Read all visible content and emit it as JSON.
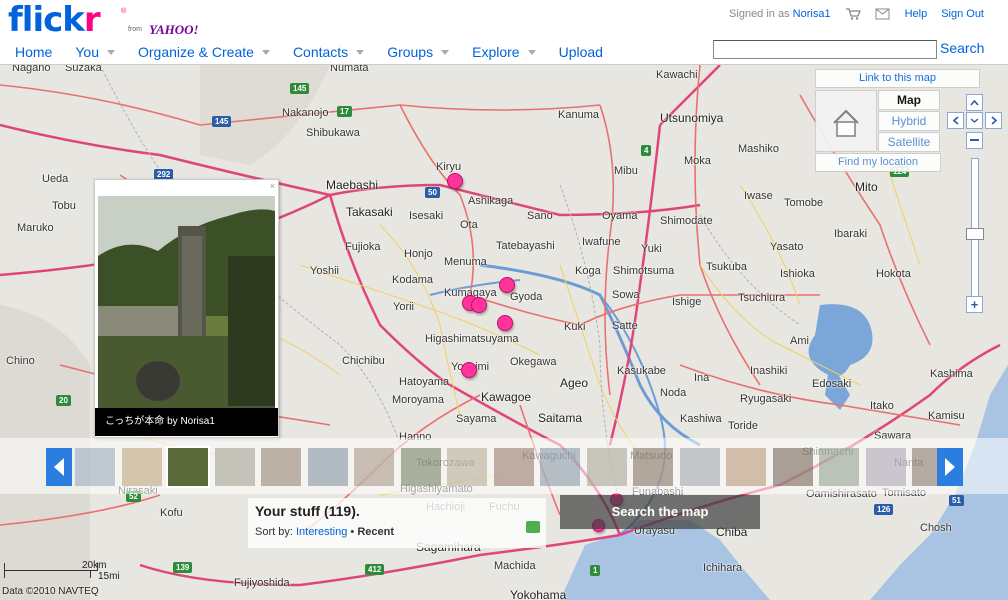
{
  "header": {
    "logo_word": "flickr",
    "logo_reg": "®",
    "logo_from": "from",
    "logo_yahoo": "YAHOO!",
    "signed_in_prefix": "Signed in as",
    "username": "Norisa1",
    "help": "Help",
    "sign_out": "Sign Out",
    "nav": [
      {
        "label": "Home",
        "caret": false
      },
      {
        "label": "You",
        "caret": true
      },
      {
        "label": "Organize & Create",
        "caret": true
      },
      {
        "label": "Contacts",
        "caret": true
      },
      {
        "label": "Groups",
        "caret": true
      },
      {
        "label": "Explore",
        "caret": true
      },
      {
        "label": "Upload",
        "caret": false
      }
    ],
    "search_value": "",
    "search_button": "Search"
  },
  "map_controls": {
    "link_to_map": "Link to this map",
    "map": "Map",
    "hybrid": "Hybrid",
    "satellite": "Satellite",
    "find_location": "Find my location",
    "zoom_in": "+"
  },
  "cities": [
    {
      "name": "Nagano",
      "big": false
    },
    {
      "name": "Suzaka",
      "big": false
    },
    {
      "name": "Numata",
      "big": false
    },
    {
      "name": "Kawachi",
      "big": false
    },
    {
      "name": "Kanuma",
      "big": false
    },
    {
      "name": "Utsunomiya",
      "big": true
    },
    {
      "name": "Nakanojo",
      "big": false
    },
    {
      "name": "Shibukawa",
      "big": false
    },
    {
      "name": "Kiryu",
      "big": false
    },
    {
      "name": "Maebashi",
      "big": true
    },
    {
      "name": "Ashikaga",
      "big": false
    },
    {
      "name": "Ueda",
      "big": false
    },
    {
      "name": "Tobu",
      "big": false
    },
    {
      "name": "Takasaki",
      "big": true
    },
    {
      "name": "Isesaki",
      "big": false
    },
    {
      "name": "Ota",
      "big": false
    },
    {
      "name": "Sano",
      "big": false
    },
    {
      "name": "Oyama",
      "big": false
    },
    {
      "name": "Shimodate",
      "big": false
    },
    {
      "name": "Maruko",
      "big": false
    },
    {
      "name": "Fujioka",
      "big": false
    },
    {
      "name": "Honjo",
      "big": false
    },
    {
      "name": "Tatebayashi",
      "big": false
    },
    {
      "name": "Iwafune",
      "big": false
    },
    {
      "name": "Yuki",
      "big": false
    },
    {
      "name": "Yoshii",
      "big": false
    },
    {
      "name": "Menuma",
      "big": false
    },
    {
      "name": "Koga",
      "big": false
    },
    {
      "name": "Shimotsuma",
      "big": false
    },
    {
      "name": "Kodama",
      "big": false
    },
    {
      "name": "Kumagaya",
      "big": false
    },
    {
      "name": "Gyoda",
      "big": false
    },
    {
      "name": "Sowa",
      "big": false
    },
    {
      "name": "Yorii",
      "big": false
    },
    {
      "name": "Higashimatsuyama",
      "big": false
    },
    {
      "name": "Kuki",
      "big": false
    },
    {
      "name": "Satte",
      "big": false
    },
    {
      "name": "Okegawa",
      "big": false
    },
    {
      "name": "Chino",
      "big": false
    },
    {
      "name": "Chichibu",
      "big": false
    },
    {
      "name": "Yoshimi",
      "big": false
    },
    {
      "name": "Ageo",
      "big": true
    },
    {
      "name": "Kasukabe",
      "big": false
    },
    {
      "name": "Hatoyama",
      "big": false
    },
    {
      "name": "Moroyama",
      "big": false
    },
    {
      "name": "Kawagoe",
      "big": true
    },
    {
      "name": "Saitama",
      "big": true
    },
    {
      "name": "Sayama",
      "big": false
    },
    {
      "name": "Hanno",
      "big": false
    },
    {
      "name": "Tokorozawa",
      "big": false
    },
    {
      "name": "Kawaguchi",
      "big": false
    },
    {
      "name": "Matsudo",
      "big": false
    },
    {
      "name": "Higashiyamato",
      "big": false
    },
    {
      "name": "Hachioji",
      "big": false
    },
    {
      "name": "Fuchu",
      "big": false
    },
    {
      "name": "Funabashi",
      "big": false
    },
    {
      "name": "Kofu",
      "big": false
    },
    {
      "name": "Sagamihara",
      "big": true
    },
    {
      "name": "Machida",
      "big": false
    },
    {
      "name": "Urayasu",
      "big": false
    },
    {
      "name": "Chiba",
      "big": true
    },
    {
      "name": "Ichihara",
      "big": false
    },
    {
      "name": "Yokohama",
      "big": true
    },
    {
      "name": "Fujiyoshida",
      "big": false
    },
    {
      "name": "Nirasaki",
      "big": false
    },
    {
      "name": "Mibu",
      "big": false
    },
    {
      "name": "Moka",
      "big": false
    },
    {
      "name": "Mashiko",
      "big": false
    },
    {
      "name": "Iwase",
      "big": false
    },
    {
      "name": "Mito",
      "big": true
    },
    {
      "name": "Tomobe",
      "big": false
    },
    {
      "name": "Ibaraki",
      "big": false
    },
    {
      "name": "Yasato",
      "big": false
    },
    {
      "name": "Tsukuba",
      "big": false
    },
    {
      "name": "Ishioka",
      "big": false
    },
    {
      "name": "Hokota",
      "big": false
    },
    {
      "name": "Tsuchiura",
      "big": false
    },
    {
      "name": "Ishige",
      "big": false
    },
    {
      "name": "Ami",
      "big": false
    },
    {
      "name": "Inashiki",
      "big": false
    },
    {
      "name": "Edosaki",
      "big": false
    },
    {
      "name": "Ina",
      "big": false
    },
    {
      "name": "Noda",
      "big": false
    },
    {
      "name": "Ryugasaki",
      "big": false
    },
    {
      "name": "Kashiwa",
      "big": false
    },
    {
      "name": "Toride",
      "big": false
    },
    {
      "name": "Kashima",
      "big": false
    },
    {
      "name": "Itako",
      "big": false
    },
    {
      "name": "Kamisu",
      "big": false
    },
    {
      "name": "Sawara",
      "big": false
    },
    {
      "name": "Narita",
      "big": false
    },
    {
      "name": "Tomisato",
      "big": false
    },
    {
      "name": "Oamishirasato",
      "big": false
    },
    {
      "name": "Chosh",
      "big": false
    },
    {
      "name": "Shinmachi",
      "big": false
    }
  ],
  "shields": [
    "145",
    "17",
    "145",
    "292",
    "50",
    "4",
    "20",
    "52",
    "139",
    "412",
    "1",
    "126",
    "51",
    "124"
  ],
  "popup": {
    "close": "×",
    "caption_title": "こっちが本命",
    "caption_by": "by",
    "caption_user": "Norisa1"
  },
  "your_stuff": {
    "title": "Your stuff (119).",
    "sort_by": "Sort by:",
    "interesting": "Interesting",
    "bullet": "•",
    "recent": "Recent"
  },
  "search_map": "Search the map",
  "scale": {
    "km": "20km",
    "mi": "15mi"
  },
  "copyright": "Data ©2010 NAVTEQ"
}
